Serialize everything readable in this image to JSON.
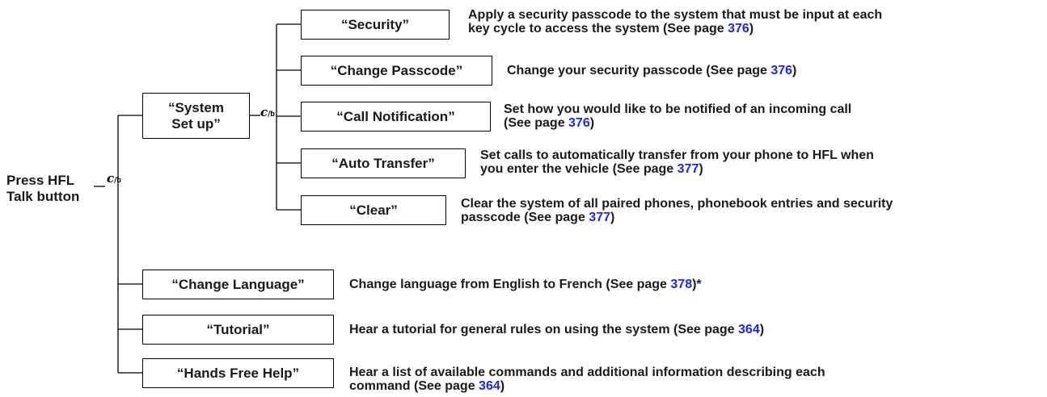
{
  "root": {
    "line1": "Press HFL",
    "line2": "Talk button"
  },
  "talk_icon": "voice-talk-icon",
  "system_setup": {
    "line1": "“System",
    "line2": "Set up”"
  },
  "setup_items": [
    {
      "label": "“Security”",
      "desc1_pre": "Apply a security passcode to the system that must be input at each",
      "desc2_pre": "key cycle to access the system (See page ",
      "page": "376",
      "desc2_post": ")"
    },
    {
      "label": "“Change Passcode”",
      "desc1_pre": "Change your security passcode (See page ",
      "page": "376",
      "desc1_post": ")"
    },
    {
      "label": "“Call Notification”",
      "desc1_pre": "Set how you would like to be notified of an incoming call",
      "desc2_pre": "(See page ",
      "page": "376",
      "desc2_post": ")"
    },
    {
      "label": "“Auto Transfer”",
      "desc1_pre": "Set calls to automatically transfer from your phone to HFL when",
      "desc2_pre": "you enter the vehicle (See page ",
      "page": "377",
      "desc2_post": ")"
    },
    {
      "label": "“Clear”",
      "desc1_pre": "Clear the system of all paired phones, phonebook entries and security",
      "desc2_pre": "passcode (See page ",
      "page": "377",
      "desc2_post": ")"
    }
  ],
  "main_items": [
    {
      "label": "“Change Language”",
      "desc1_pre": "Change language from English to French (See page ",
      "page": "378",
      "desc1_post": ")*"
    },
    {
      "label": "“Tutorial”",
      "desc1_pre": "Hear a tutorial for general rules on using the system (See page ",
      "page": "364",
      "desc1_post": ")"
    },
    {
      "label": "“Hands Free Help”",
      "desc1_pre": "Hear a list of available commands and additional information describing each",
      "desc2_pre": "command (See page ",
      "page": "364",
      "desc2_post": ")"
    }
  ],
  "colors": {
    "page_link": "#1a24ff",
    "line": "#000000",
    "text": "#1a1a1a"
  }
}
